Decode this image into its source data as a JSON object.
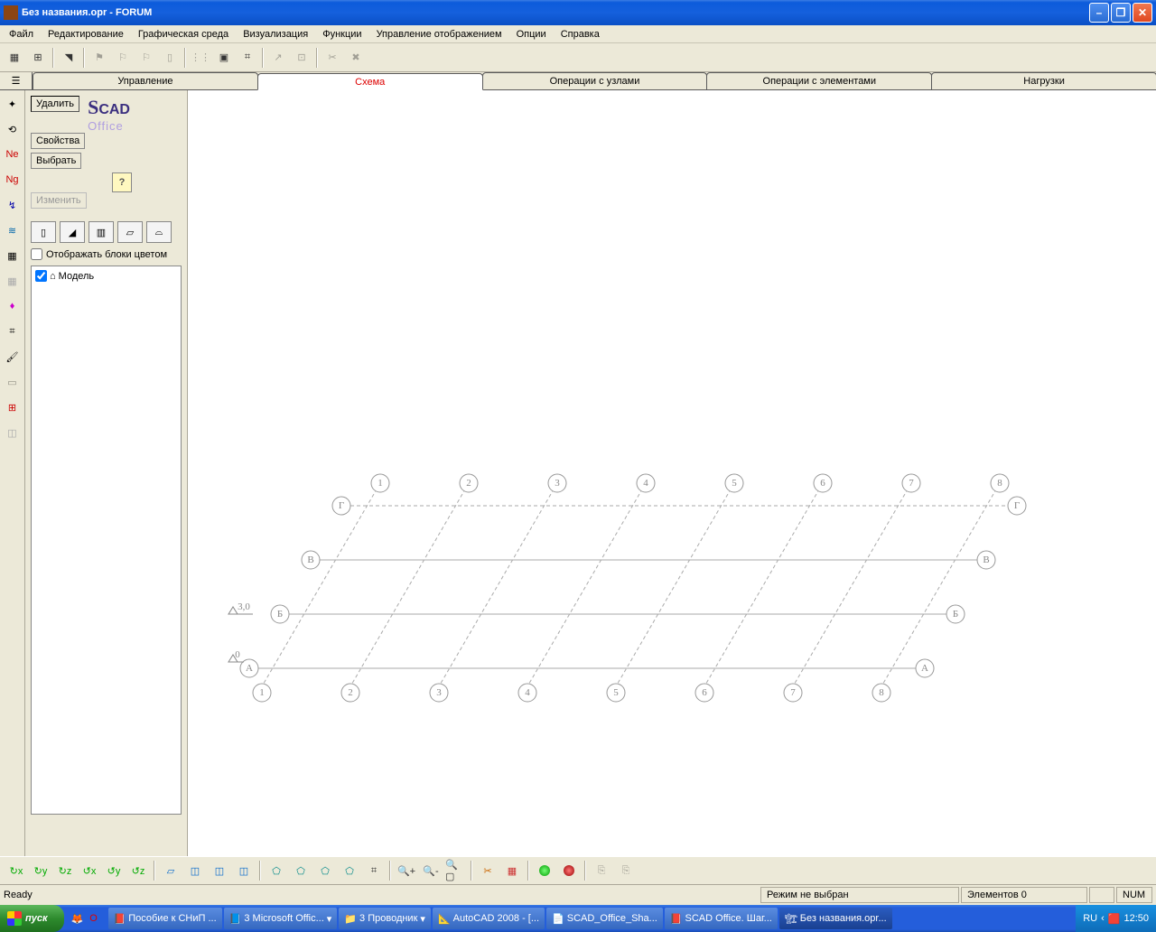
{
  "window": {
    "title": "Без названия.opr - FORUM"
  },
  "menu": [
    "Файл",
    "Редактирование",
    "Графическая среда",
    "Визуализация",
    "Функции",
    "Управление отображением",
    "Опции",
    "Справка"
  ],
  "tabs": [
    {
      "label": "Управление",
      "active": false
    },
    {
      "label": "Схема",
      "active": true
    },
    {
      "label": "Операции с узлами",
      "active": false
    },
    {
      "label": "Операции с элементами",
      "active": false
    },
    {
      "label": "Нагрузки",
      "active": false
    }
  ],
  "sidepanel": {
    "btn_delete": "Удалить",
    "btn_props": "Свойства",
    "btn_select": "Выбрать",
    "btn_modify": "Изменить",
    "chk_color": "Отображать блоки цветом",
    "tree_root": "Модель",
    "logo_top": "SCAD",
    "logo_bottom": "Office"
  },
  "diagram": {
    "cols_top": [
      "1",
      "2",
      "3",
      "4",
      "5",
      "6",
      "7",
      "8"
    ],
    "cols_bottom": [
      "1",
      "2",
      "3",
      "4",
      "5",
      "6",
      "7",
      "8"
    ],
    "rows_left": [
      "Г",
      "В",
      "Б",
      "А"
    ],
    "rows_right": [
      "Г",
      "В",
      "Б",
      "А"
    ],
    "elev": [
      "3,0",
      "0"
    ]
  },
  "status": {
    "left": "Ready",
    "mode": "Режим не выбран",
    "elements": "Элементов 0",
    "num": "NUM"
  },
  "taskbar": {
    "start": "пуск",
    "items": [
      "Пособие к СНиП ...",
      "3 Microsoft Offic...",
      "3 Проводник",
      "AutoCAD 2008 - [...",
      "SCAD_Office_Sha...",
      "SCAD Office. Шаг...",
      "Без названия.opr..."
    ],
    "lang": "RU",
    "time": "12:50"
  }
}
